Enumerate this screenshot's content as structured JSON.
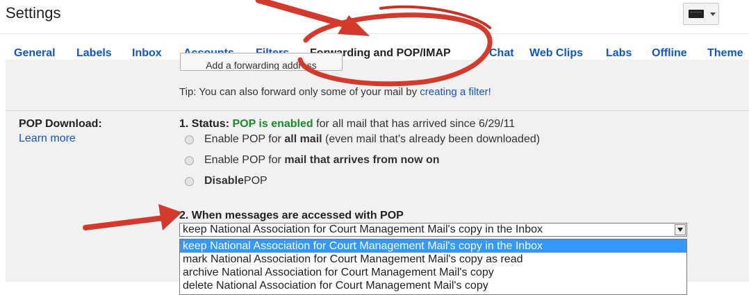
{
  "header": {
    "title": "Settings",
    "keyboard_icon": "keyboard-icon",
    "dropdown_icon": "chevron-down-icon"
  },
  "tabs": [
    {
      "label": "General"
    },
    {
      "label": "Labels"
    },
    {
      "label": "Inbox"
    },
    {
      "label": "Accounts"
    },
    {
      "label": "Filters"
    },
    {
      "label": "Forwarding and POP/IMAP"
    },
    {
      "label": "Chat"
    },
    {
      "label": "Web Clips"
    },
    {
      "label": "Labs"
    },
    {
      "label": "Offline"
    },
    {
      "label": "Theme"
    }
  ],
  "active_tab": "Forwarding and POP/IMAP",
  "forwarding": {
    "add_button_label": "Add a forwarding address",
    "tip_prefix": "Tip: You can also forward only some of your mail by ",
    "tip_link": "creating a filter!"
  },
  "pop": {
    "label": "POP Download:",
    "learn_more": "Learn more",
    "status_prefix": "1. Status:",
    "status_enabled": "POP is enabled",
    "status_suffix": "for all mail that has arrived since 6/29/11",
    "options": [
      {
        "pre": "Enable POP for ",
        "bold": "all mail",
        "post": " (even mail that's already been downloaded)"
      },
      {
        "pre": "Enable POP for ",
        "bold": "mail that arrives from now on",
        "post": ""
      },
      {
        "pre": "",
        "bold": "Disable",
        "post": " POP"
      }
    ],
    "when_label": "2. When messages are accessed with POP",
    "selected": "keep National Association for Court Management Mail's copy in the Inbox",
    "dropdown_options": [
      "keep National Association for Court Management Mail's copy in the Inbox",
      "mark National Association for Court Management Mail's copy as read",
      "archive National Association for Court Management Mail's copy",
      "delete National Association for Court Management Mail's copy"
    ]
  },
  "colors": {
    "link": "#1155cc",
    "enabled": "#1c8a2b",
    "annotation": "#d33a2c",
    "selection": "#3399ff"
  }
}
